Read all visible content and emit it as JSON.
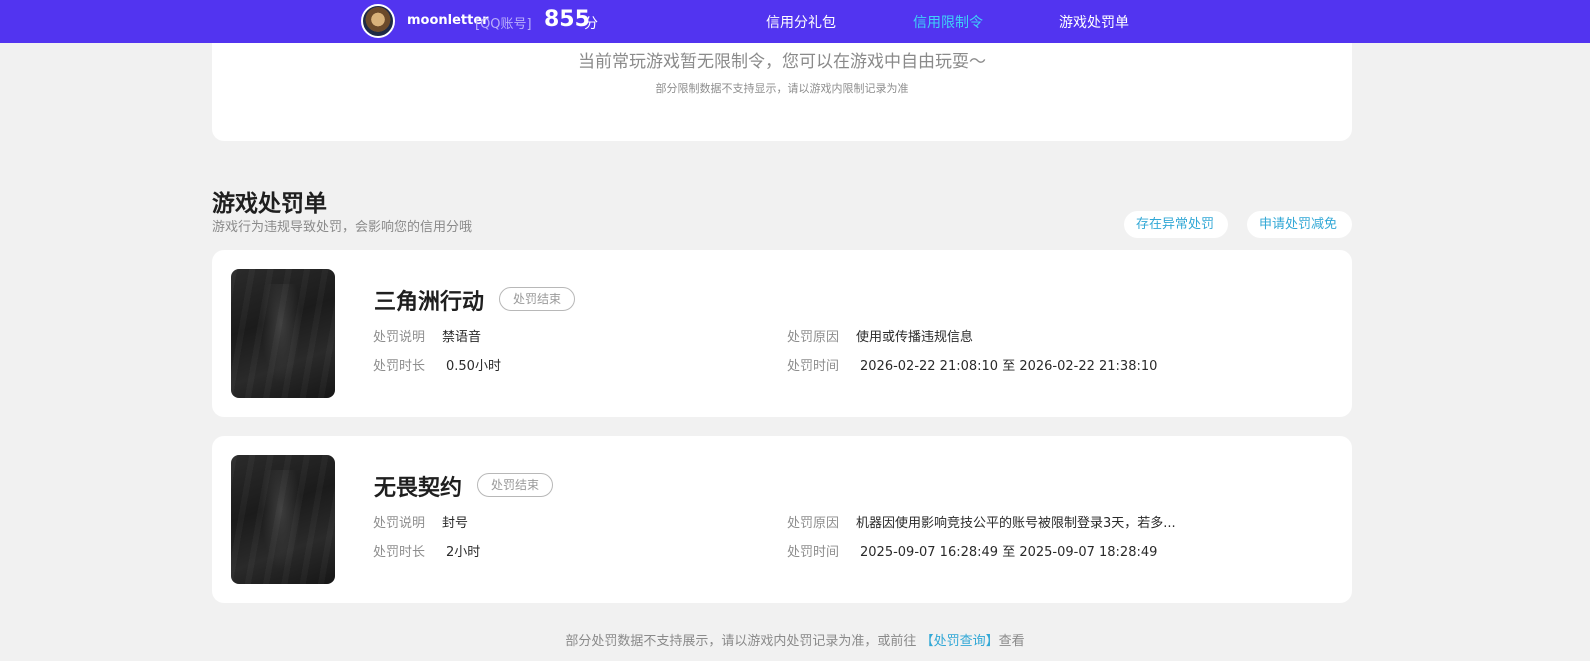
{
  "header": {
    "username": "moonletter",
    "account_type": "[QQ账号]",
    "score": "855",
    "score_unit": "分",
    "nav": [
      "信用分礼包",
      "信用限制令",
      "游戏处罚单"
    ],
    "active_nav": "信用限制令",
    "accent_color": "#5234f0",
    "active_color": "#3fd2f7"
  },
  "restriction": {
    "message": "当前常玩游戏暂无限制令，您可以在游戏中自由玩耍～",
    "note": "部分限制数据不支持显示，请以游戏内限制记录为准"
  },
  "punishments": {
    "title": "游戏处罚单",
    "description": "游戏行为违规导致处罚，会影响您的信用分哦",
    "buttons": {
      "abnormal": "存在异常处罚",
      "appeal": "申请处罚减免"
    },
    "labels": {
      "desc": "处罚说明",
      "duration": "处罚时长",
      "reason": "处罚原因",
      "time": "处罚时间"
    },
    "items": [
      {
        "game": "三角洲行动",
        "status": "处罚结束",
        "desc": "禁语音",
        "duration": "0.50小时",
        "reason": "使用或传播违规信息",
        "time": "2026-02-22 21:08:10 至 2026-02-22 21:38:10"
      },
      {
        "game": "无畏契约",
        "status": "处罚结束",
        "desc": "封号",
        "duration": "2小时",
        "reason": "机器因使用影响竞技公平的账号被限制登录3天，若多...",
        "time": "2025-09-07 16:28:49 至 2025-09-07 18:28:49"
      }
    ]
  },
  "footer": {
    "prefix": "部分处罚数据不支持展示，请以游戏内处罚记录为准，或前往",
    "link": "【处罚查询】",
    "suffix": "查看"
  }
}
